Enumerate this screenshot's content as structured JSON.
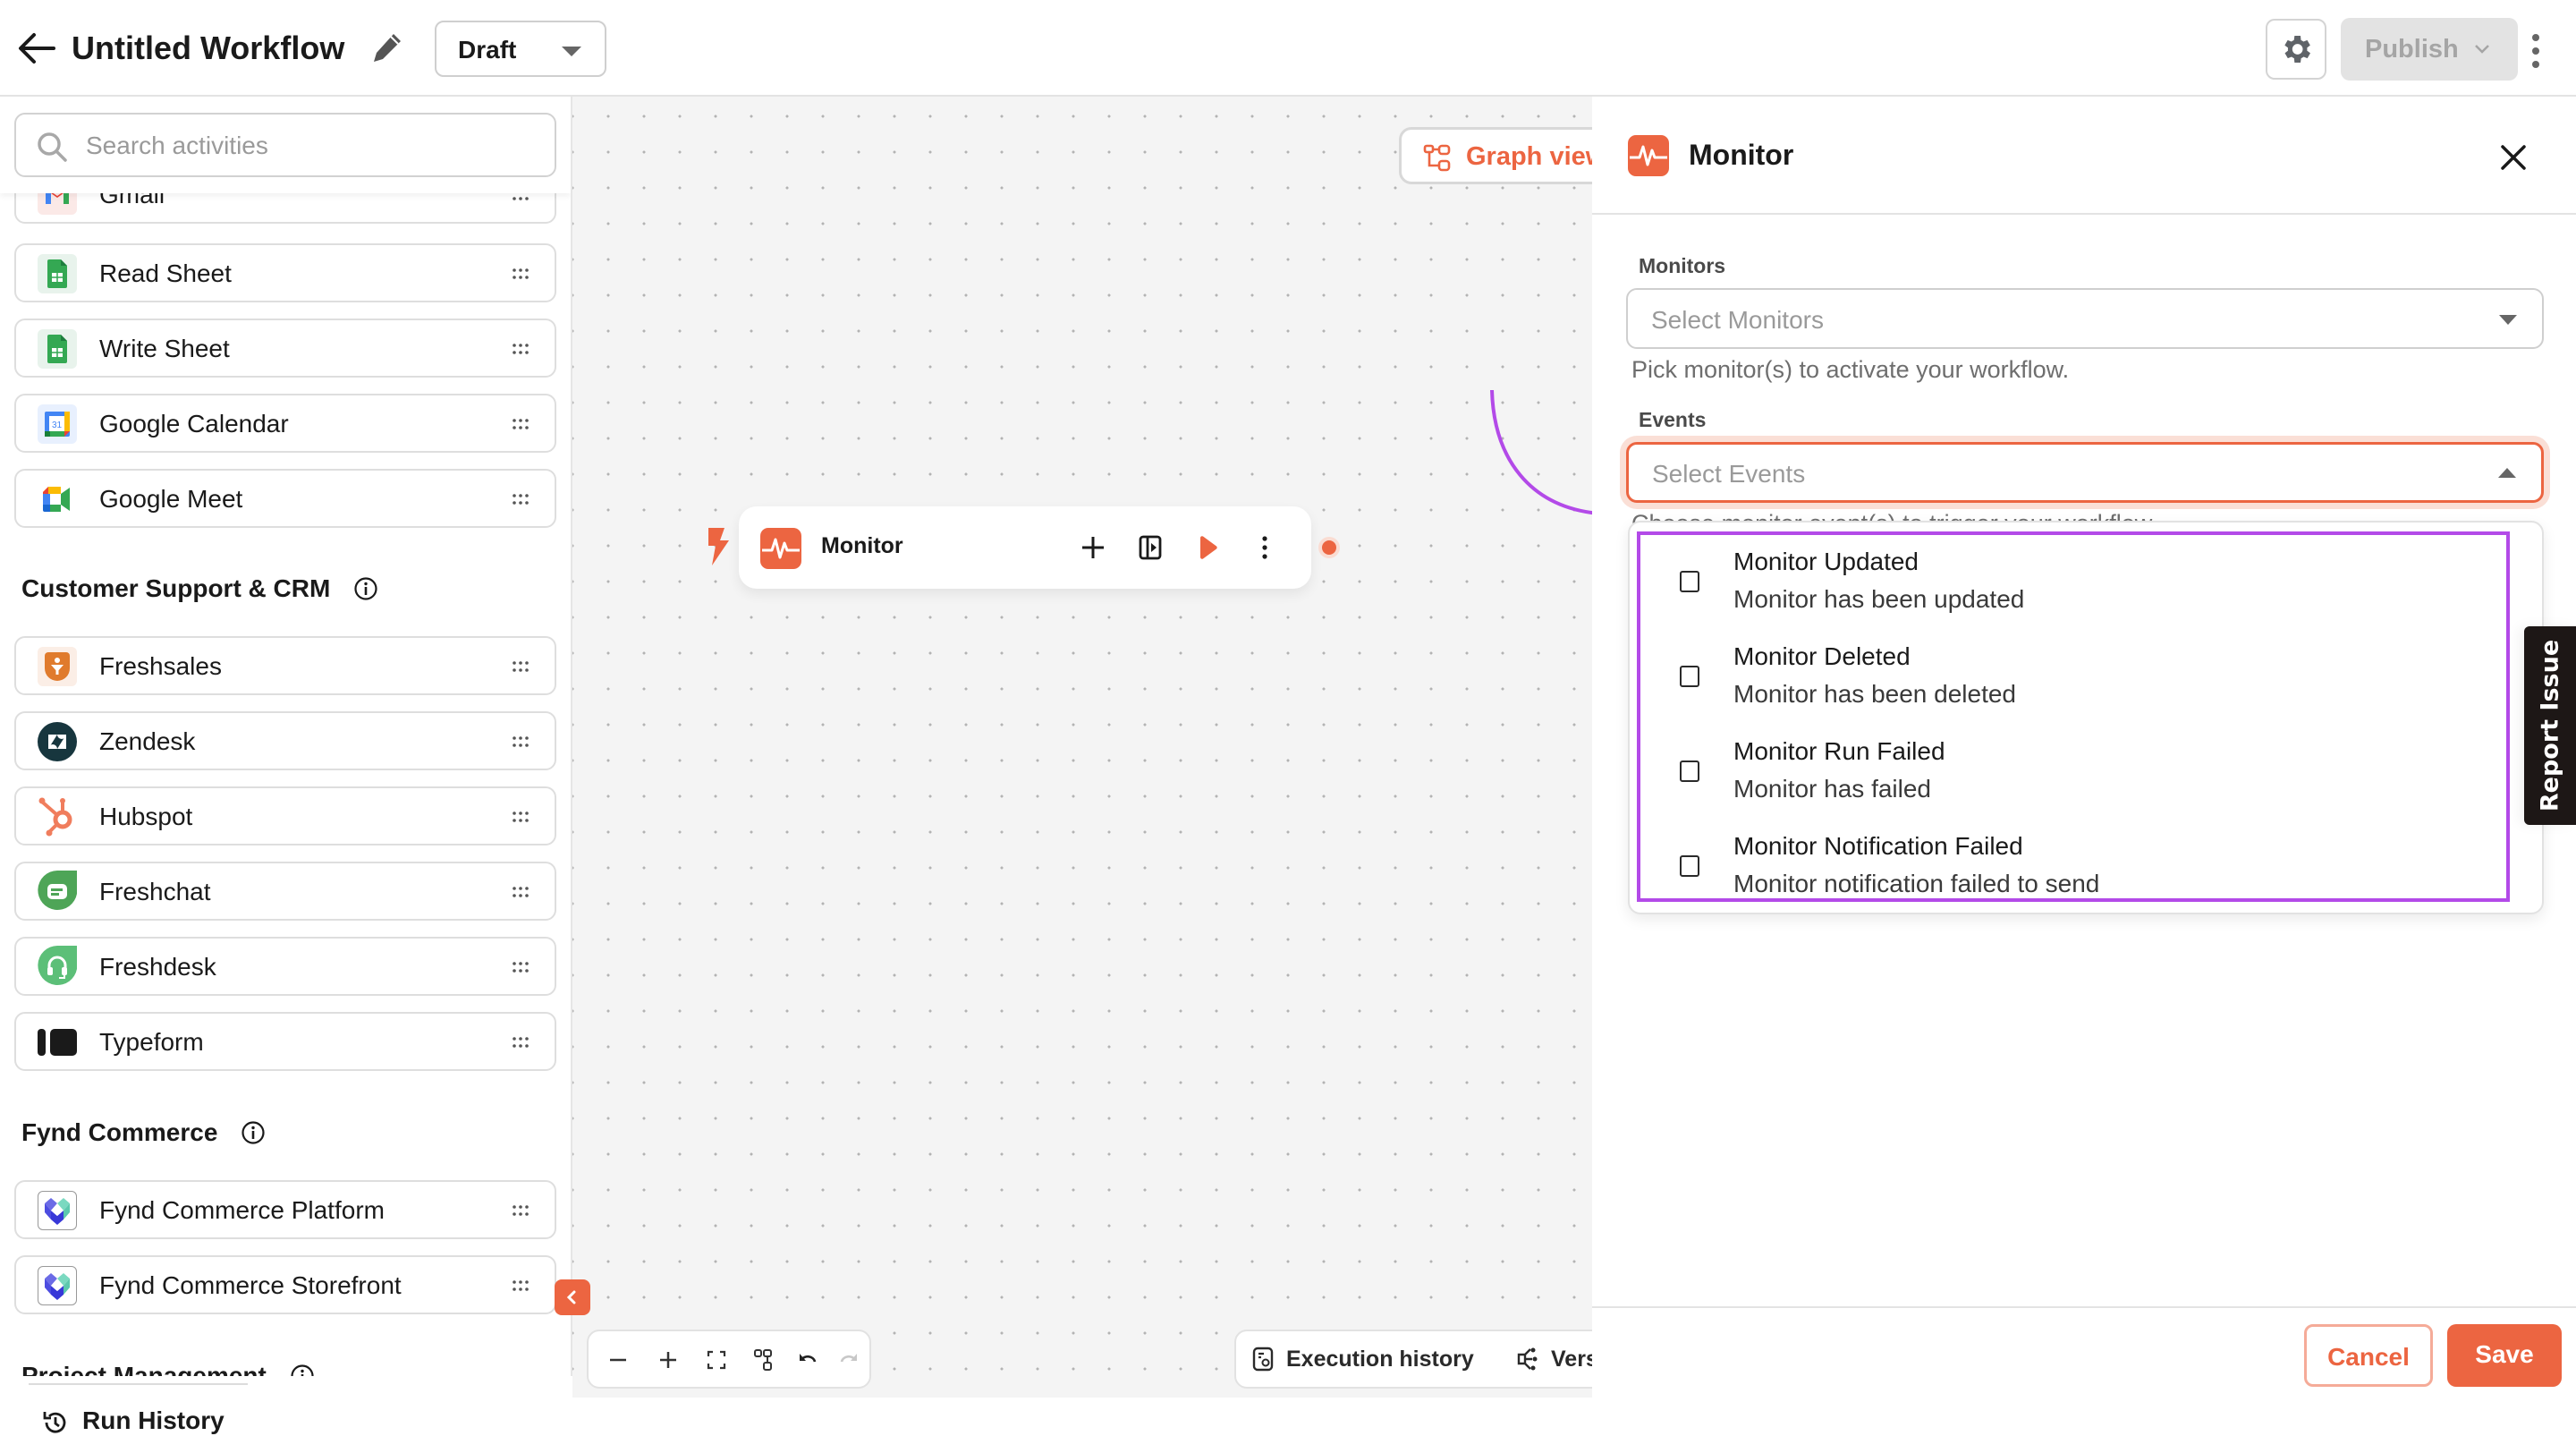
{
  "header": {
    "title": "Untitled Workflow",
    "status": "Draft",
    "publish_label": "Publish"
  },
  "sidebar": {
    "search_placeholder": "Search activities",
    "partial_item": "Gmail",
    "items_top": [
      {
        "label": "Read Sheet",
        "icon": "google-sheets-icon"
      },
      {
        "label": "Write Sheet",
        "icon": "google-sheets-icon"
      },
      {
        "label": "Google Calendar",
        "icon": "google-calendar-icon"
      },
      {
        "label": "Google Meet",
        "icon": "google-meet-icon"
      }
    ],
    "sections": [
      {
        "title": "Customer Support & CRM",
        "items": [
          {
            "label": "Freshsales",
            "icon": "freshsales-icon"
          },
          {
            "label": "Zendesk",
            "icon": "zendesk-icon"
          },
          {
            "label": "Hubspot",
            "icon": "hubspot-icon"
          },
          {
            "label": "Freshchat",
            "icon": "freshchat-icon"
          },
          {
            "label": "Freshdesk",
            "icon": "freshdesk-icon"
          },
          {
            "label": "Typeform",
            "icon": "typeform-icon"
          }
        ]
      },
      {
        "title": "Fynd Commerce",
        "items": [
          {
            "label": "Fynd Commerce Platform",
            "icon": "fynd-icon"
          },
          {
            "label": "Fynd Commerce Storefront",
            "icon": "fynd-icon"
          }
        ]
      },
      {
        "title": "Project Management",
        "items": []
      }
    ],
    "run_history_label": "Run History"
  },
  "canvas": {
    "graph_view_label": "Graph view",
    "node": {
      "label": "Monitor"
    },
    "execution_history_label": "Execution history",
    "versions_label": "Versions"
  },
  "panel": {
    "title": "Monitor",
    "monitors": {
      "label": "Monitors",
      "placeholder": "Select Monitors",
      "helper": "Pick monitor(s) to activate your workflow."
    },
    "events": {
      "label": "Events",
      "placeholder": "Select Events",
      "helper": "Choose monitor event(s) to trigger your workflow.",
      "options": [
        {
          "title": "Monitor Updated",
          "description": "Monitor has been updated",
          "checked": false
        },
        {
          "title": "Monitor Deleted",
          "description": "Monitor has been deleted",
          "checked": false
        },
        {
          "title": "Monitor Run Failed",
          "description": "Monitor has failed",
          "checked": false
        },
        {
          "title": "Monitor Notification Failed",
          "description": "Monitor notification failed to send",
          "checked": false
        }
      ]
    },
    "cancel_label": "Cancel",
    "save_label": "Save"
  },
  "report_issue_label": "Report Issue",
  "colors": {
    "accent": "#ec6541",
    "highlight": "#b34ae8",
    "disabled_bg": "#e3e3e3"
  }
}
